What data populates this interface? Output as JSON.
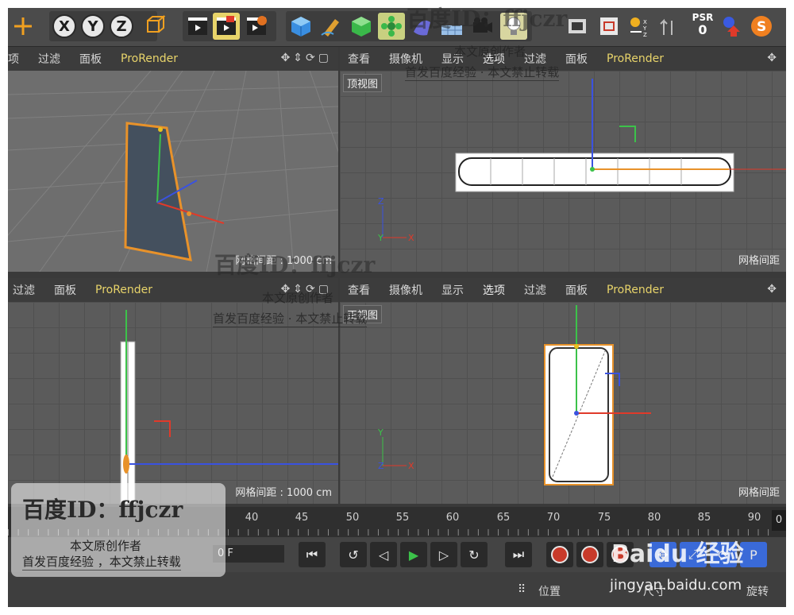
{
  "toolbar": {
    "axis_x": "X",
    "axis_y": "Y",
    "axis_z": "Z",
    "psr_label": "PSR",
    "psr_value": "0",
    "icons": [
      "move-icon",
      "coordinate-system-icon",
      "render-view-icon",
      "render-region-icon",
      "render-settings-icon",
      "cube-icon",
      "pen-icon",
      "subdivision-icon",
      "array-icon",
      "deformer-icon",
      "floor-icon",
      "camera-icon",
      "light-icon",
      "snap-icon",
      "axis-lock-icon",
      "enable-axis-icon",
      "psr-icon",
      "s-icon"
    ]
  },
  "viewports": {
    "top_left": {
      "menu": [
        "项",
        "过滤",
        "面板",
        "ProRender"
      ],
      "grid_spacing": "网格间距 : 1000 cm"
    },
    "top_right": {
      "menu": [
        "查看",
        "摄像机",
        "显示",
        "选项",
        "过滤",
        "面板",
        "ProRender"
      ],
      "title": "顶视图",
      "grid_spacing": "网格间距"
    },
    "bottom_left": {
      "menu": [
        "过滤",
        "面板",
        "ProRender"
      ],
      "grid_spacing": "网格间距 : 1000 cm"
    },
    "bottom_right": {
      "menu": [
        "查看",
        "摄像机",
        "显示",
        "选项",
        "过滤",
        "面板",
        "ProRender"
      ],
      "title": "正视图",
      "grid_spacing": "网格间距"
    }
  },
  "timeline": {
    "ticks": [
      "40",
      "45",
      "50",
      "55",
      "60",
      "65",
      "70",
      "75",
      "80",
      "85",
      "90"
    ],
    "end_value": "0",
    "frame_field": "0 F"
  },
  "attributes": {
    "tab_position": "位置",
    "tab_size": "尺寸",
    "tab_rotation": "旋转"
  },
  "watermark": {
    "id_line": "百度ID：ffjczr",
    "author_line": "本文原创作者",
    "notice_line": "首发百度经验 · 本文禁止转载",
    "notice_line_2": "首发百度经验 ，本文禁止转载",
    "baidu_logo": "Baidu 经验",
    "url": "jingyan.baidu.com"
  },
  "colors": {
    "axis_x": "#e03a2a",
    "axis_y": "#3cc24a",
    "axis_z": "#3a52e0",
    "selection_orange": "#e8922a",
    "prorender_yellow": "#e8d46a"
  }
}
